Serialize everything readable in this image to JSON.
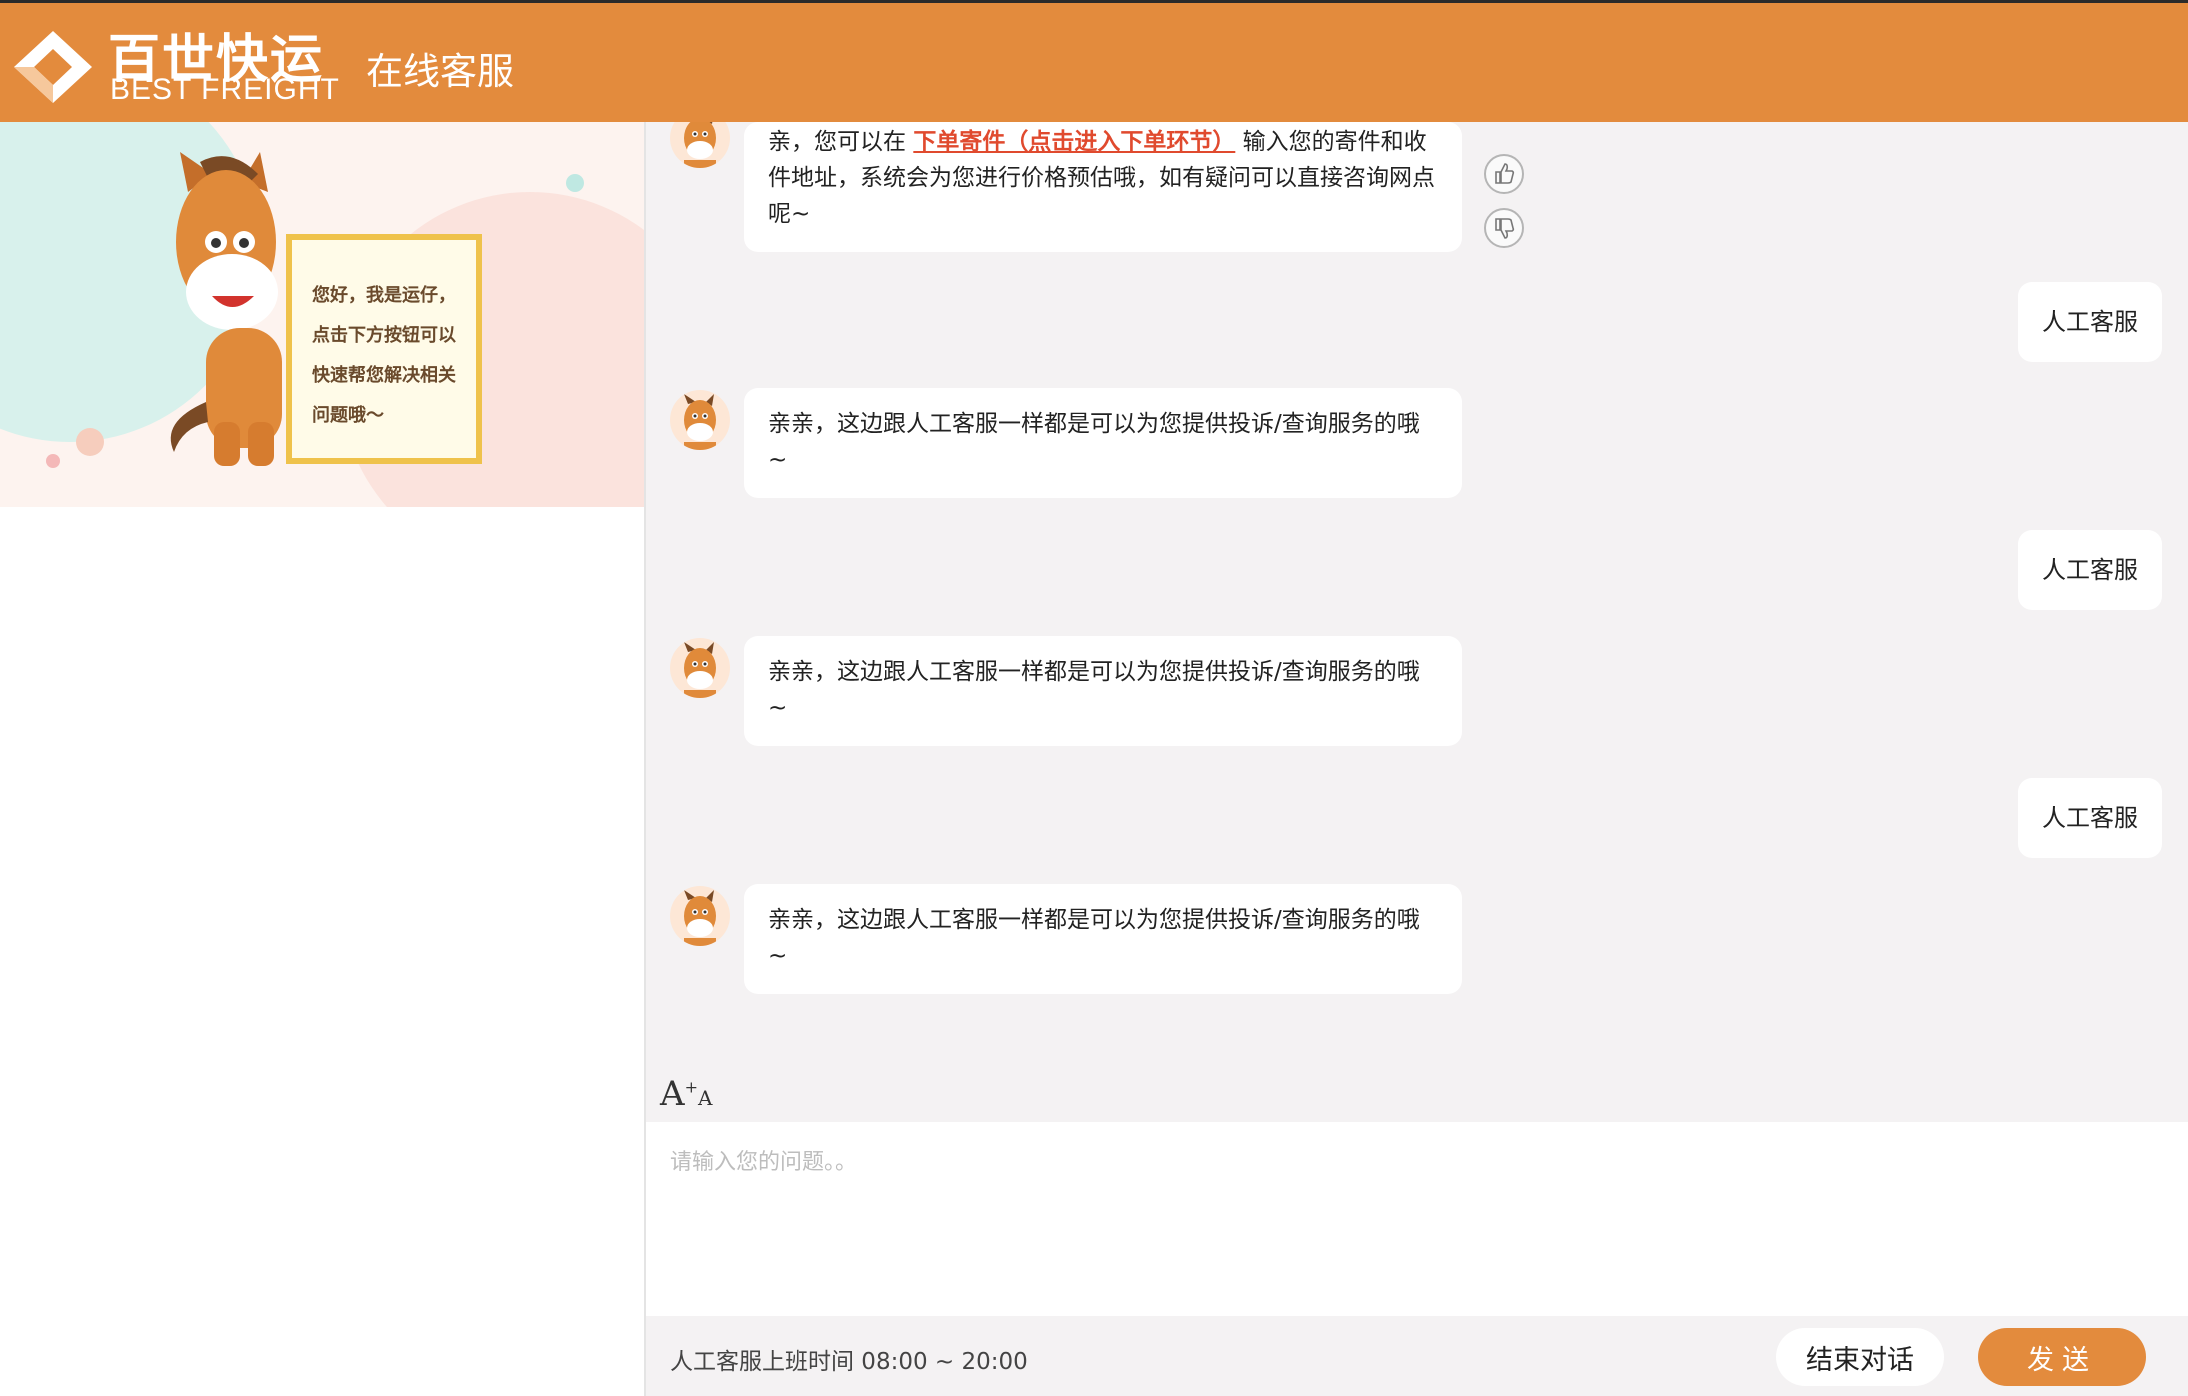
{
  "header": {
    "logo_cn": "百世快运",
    "logo_en": "BEST FREIGHT",
    "title": "在线客服"
  },
  "banner": {
    "sign_lines": [
      "您好，我是运仔，",
      "点击下方按钮可以",
      "快速帮您解决相关",
      "问题哦～"
    ]
  },
  "messages": [
    {
      "from": "bot",
      "prefix": "亲，您可以在 ",
      "link": "下单寄件（点击进入下单环节）",
      "suffix": " 输入您的寄件和收件地址，系统会为您进行价格预估哦，如有疑问可以直接咨询网点呢~"
    },
    {
      "from": "user",
      "text": "人工客服"
    },
    {
      "from": "bot",
      "text": "亲亲，这边跟人工客服一样都是可以为您提供投诉/查询服务的哦~"
    },
    {
      "from": "user",
      "text": "人工客服"
    },
    {
      "from": "bot",
      "text": "亲亲，这边跟人工客服一样都是可以为您提供投诉/查询服务的哦~"
    },
    {
      "from": "user",
      "text": "人工客服"
    },
    {
      "from": "bot",
      "text": "亲亲，这边跟人工客服一样都是可以为您提供投诉/查询服务的哦~"
    }
  ],
  "icons": {
    "font_size": "font-size-icon",
    "thumbs_up": "thumbs-up-icon",
    "thumbs_down": "thumbs-down-icon"
  },
  "input": {
    "placeholder": "请输入您的问题。。",
    "value": ""
  },
  "footer": {
    "hours_text": "人工客服上班时间 08:00 ~ 20:00",
    "end_label": "结束对话",
    "send_label": "发送"
  },
  "colors": {
    "brand": "#e38b3d",
    "link": "#e04a2e",
    "chat_bg": "#f4f2f3"
  }
}
